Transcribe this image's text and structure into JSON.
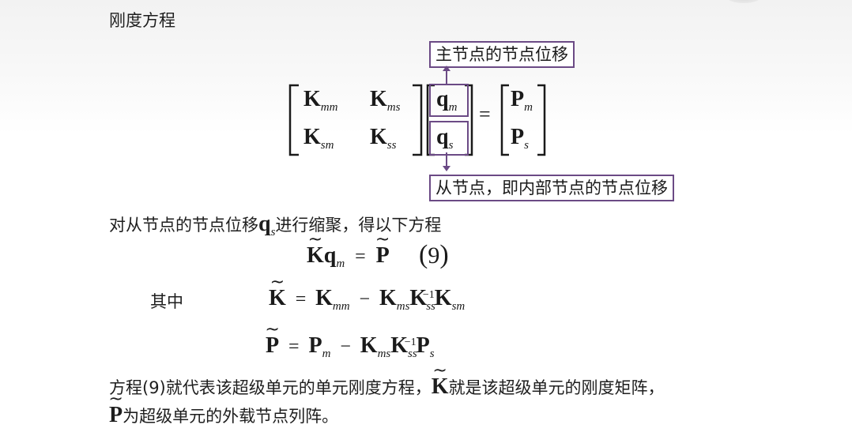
{
  "heading": "刚度方程",
  "matrix": {
    "k_mm": "mm",
    "k_ms": "ms",
    "k_sm": "sm",
    "k_ss": "ss",
    "q_m": "m",
    "q_s": "s",
    "p_m": "m",
    "p_s": "s"
  },
  "callout_top": "主节点的节点位移",
  "callout_bottom": "从节点，即内部节点的节点位移",
  "line2_prefix": "对从节点的节点位移",
  "line2_suffix": "进行缩聚，得以下方程",
  "eq9_label": "9",
  "qizhong": "其中",
  "para_a": "方程(9)就代表该超级单元的单元刚度方程，",
  "para_b": "就是该超级单元的刚度矩阵，",
  "para_c": "为超级单元的外载节点列阵。",
  "accent_color": "#6b4a85"
}
